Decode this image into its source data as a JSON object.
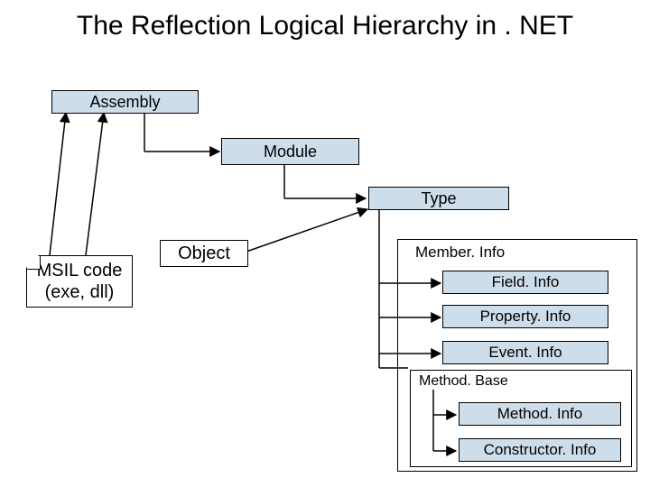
{
  "title": "The Reflection Logical Hierarchy in . NET",
  "boxes": {
    "assembly": "Assembly",
    "module": "Module",
    "type": "Type",
    "object": "Object",
    "msil": "MSIL code\n(exe, dll)",
    "memberinfo": "Member. Info",
    "fieldinfo": "Field. Info",
    "propertyinfo": "Property. Info",
    "eventinfo": "Event. Info",
    "methodbase": "Method. Base",
    "methodinfo": "Method. Info",
    "constructorinfo": "Constructor. Info"
  }
}
